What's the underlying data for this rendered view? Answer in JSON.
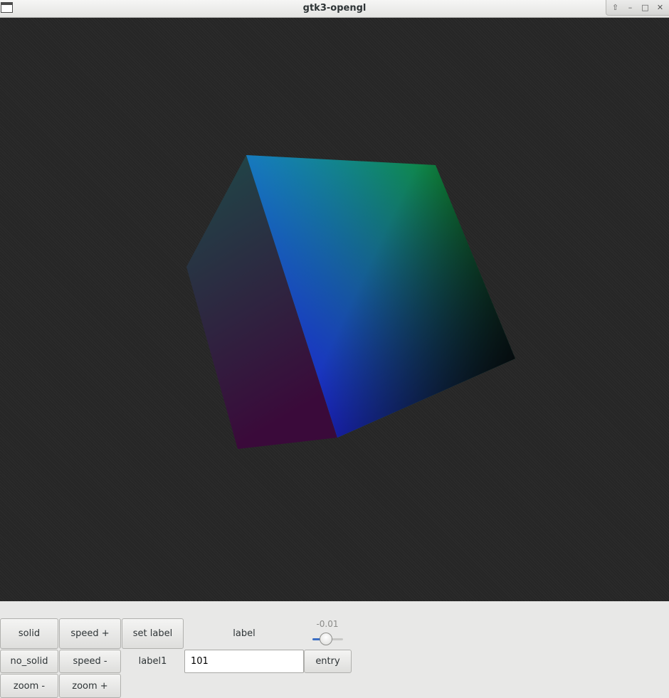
{
  "window": {
    "title": "gtk3-opengl",
    "controls": {
      "pin": "⇧",
      "minimize": "–",
      "maximize": "□",
      "close": "✕"
    }
  },
  "scene": {
    "icon": "rgb-cube",
    "colors": {
      "background": "#2a2a2a",
      "left_face_top": "#1e4a48",
      "left_face_bottom": "#3a0a3a",
      "front_top": "#12b2b0",
      "front_right": "#0d6e12",
      "front_bottom": "#1c1ad6",
      "front_far": "#05070a"
    }
  },
  "controls": {
    "solid": "solid",
    "speed_plus": "speed +",
    "set_label": "set label",
    "label": "label",
    "no_solid": "no_solid",
    "speed_minus": "speed -",
    "label1": "label1",
    "entry_value": "101",
    "entry_button": "entry",
    "zoom_minus": "zoom -",
    "zoom_plus": "zoom +",
    "slider_value_text": "-0.01",
    "slider_fraction": 0.45
  }
}
